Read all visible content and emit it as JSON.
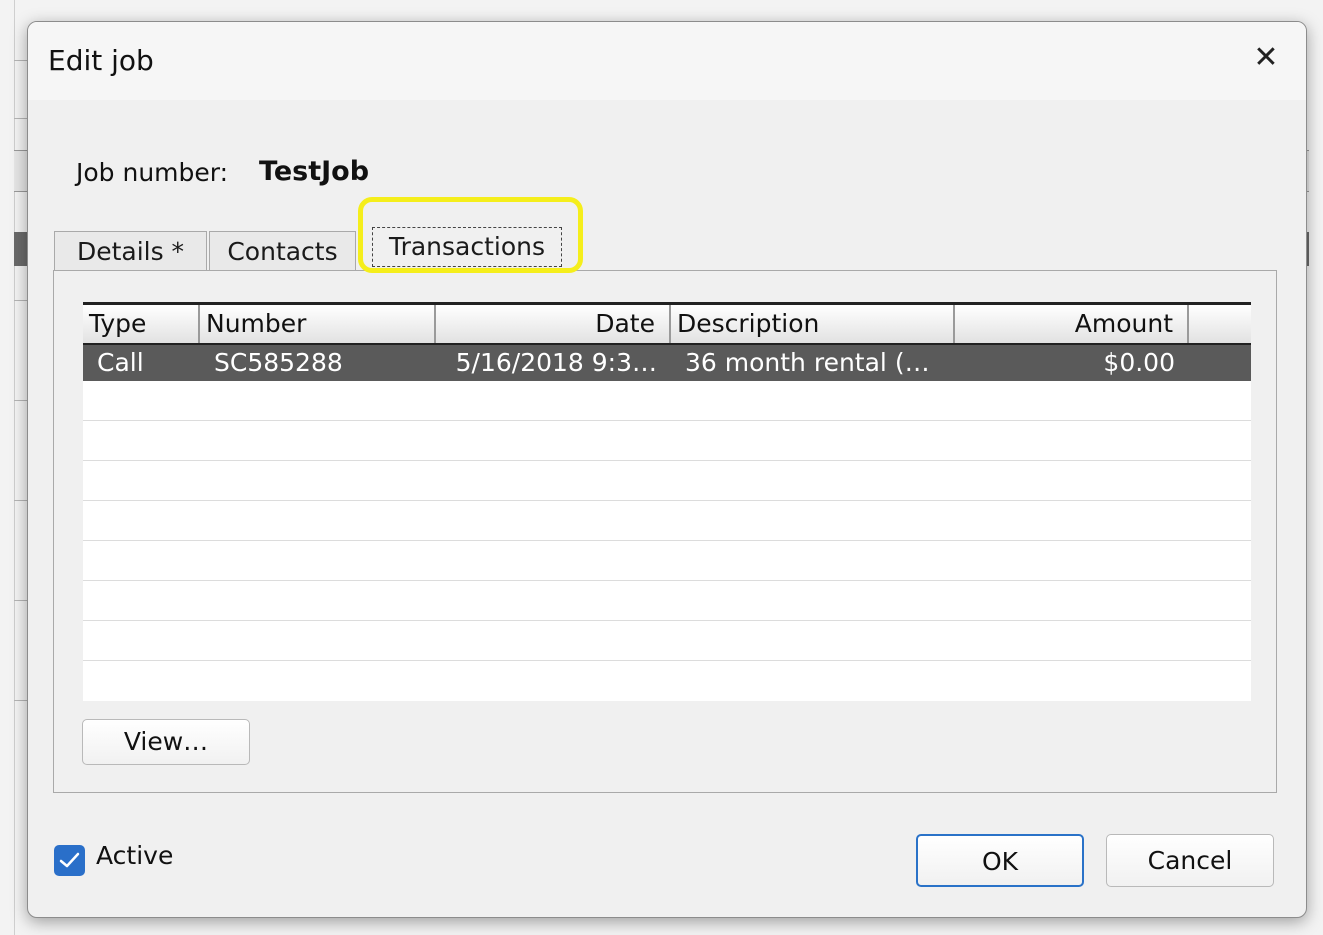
{
  "dialog": {
    "title": "Edit job",
    "close_icon": "close-icon"
  },
  "job": {
    "label": "Job number:",
    "value": "TestJob"
  },
  "tabs": [
    {
      "label": "Details *",
      "active": false
    },
    {
      "label": "Contacts",
      "active": false
    },
    {
      "label": "Transactions",
      "active": true
    }
  ],
  "highlight_color": "#f5ee1b",
  "grid": {
    "columns": [
      "Type",
      "Number",
      "Date",
      "Description",
      "Amount"
    ],
    "rows": [
      {
        "type": "Call",
        "number": "SC585288",
        "date": "5/16/2018 9:3…",
        "description": "36 month rental (…",
        "amount": "$0.00",
        "selected": true
      }
    ]
  },
  "buttons": {
    "view_label": "View…",
    "ok_label": "OK",
    "cancel_label": "Cancel"
  },
  "active_checkbox": {
    "label": "Active",
    "checked": true
  },
  "colors": {
    "selection": "#5a5a5a",
    "accent": "#2a6fc9"
  }
}
